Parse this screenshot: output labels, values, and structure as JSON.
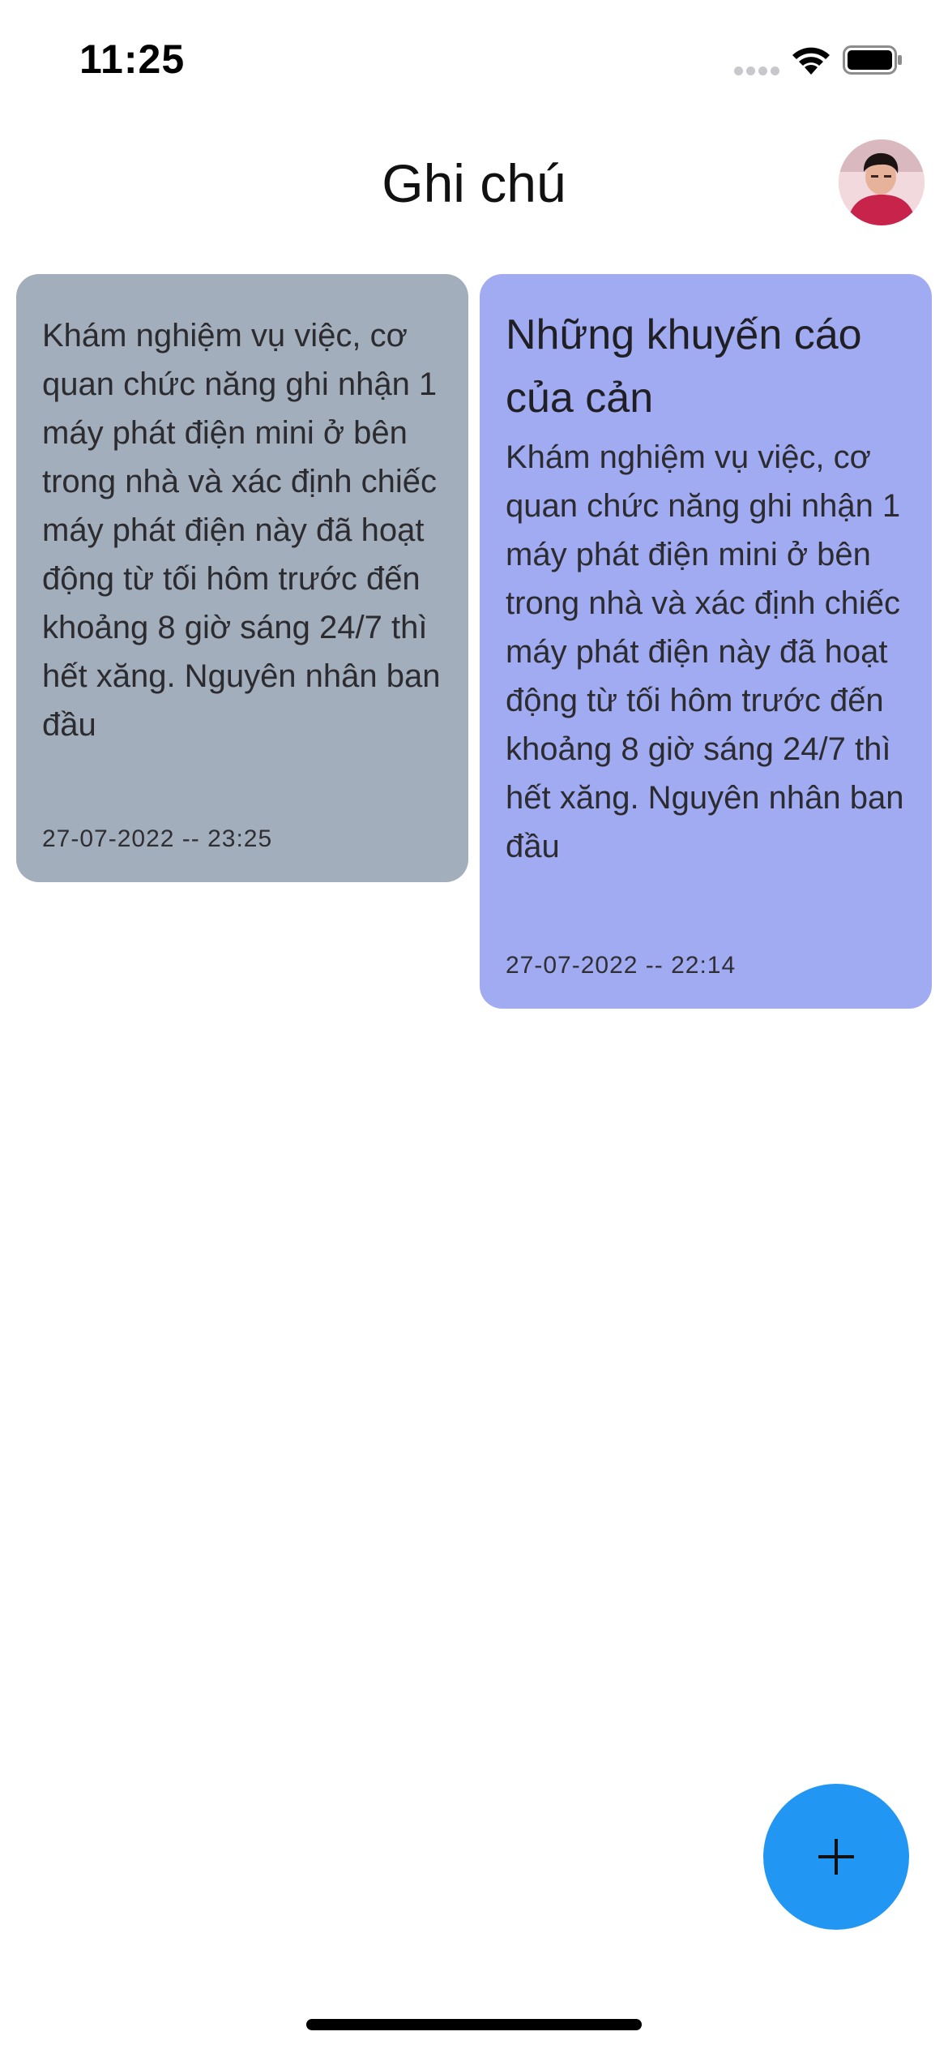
{
  "status_bar": {
    "time": "11:25"
  },
  "header": {
    "title": "Ghi chú"
  },
  "notes": [
    {
      "title": "",
      "body": "Khám nghiệm vụ việc, cơ quan chức năng ghi nhận 1 máy phát điện mini ở bên trong nhà và xác định chiếc máy phát điện này đã hoạt động từ tối hôm trước đến khoảng 8 giờ sáng 24/7 thì hết xăng. Nguyên nhân ban đầu",
      "date": "27-07-2022 -- 23:25",
      "color": "#a2aebb"
    },
    {
      "title": "Những khuyến cáo của cản",
      "body": "Khám nghiệm vụ việc, cơ quan chức năng ghi nhận 1 máy phát điện mini ở bên trong nhà và xác định chiếc máy phát điện này đã hoạt động từ tối hôm trước đến khoảng 8 giờ sáng 24/7 thì hết xăng. Nguyên nhân ban đầu",
      "date": "27-07-2022 -- 22:14",
      "color": "#a1abf1"
    }
  ],
  "fab": {
    "icon": "plus-icon",
    "color": "#2196f3"
  },
  "icons": {
    "status": [
      "signal-icon",
      "wifi-icon",
      "battery-icon"
    ],
    "avatar": "user-avatar"
  }
}
